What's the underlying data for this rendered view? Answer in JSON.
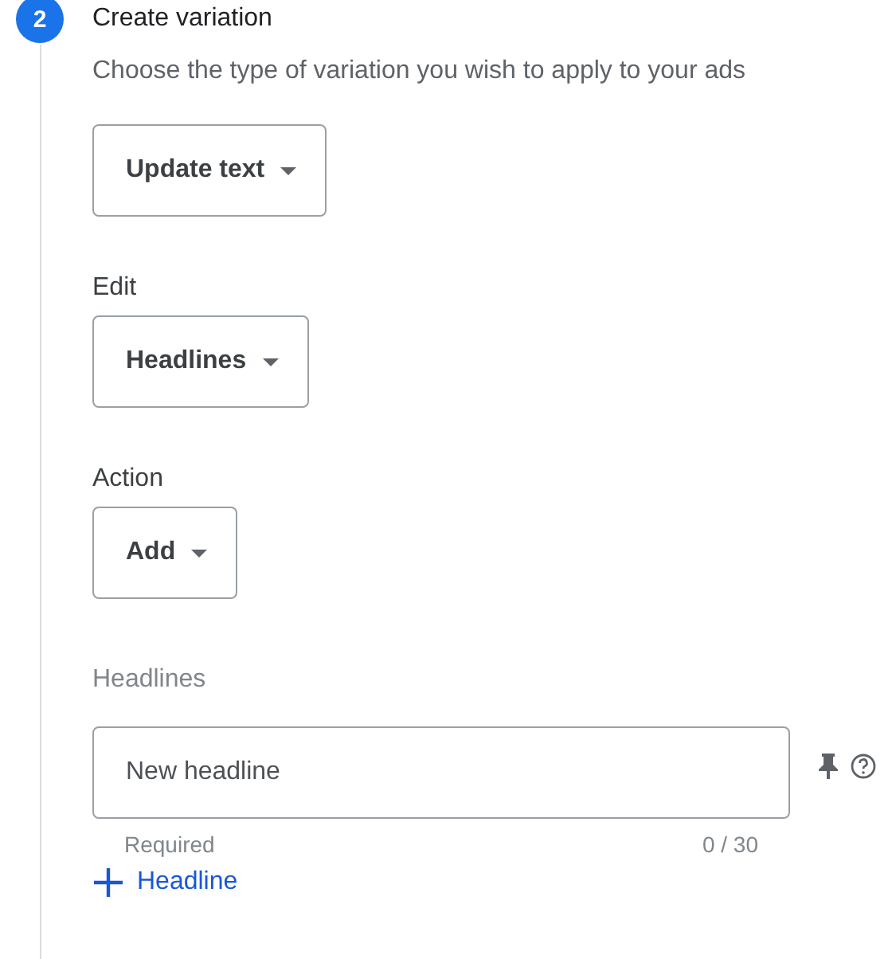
{
  "step": {
    "number": "2",
    "title": "Create variation"
  },
  "prompt": "Choose the type of variation you wish to apply to your ads",
  "dropdowns": [
    {
      "value": "Update text"
    },
    {
      "label": "Edit",
      "value": "Headlines"
    },
    {
      "label": "Action",
      "value": "Add"
    }
  ],
  "headlines": {
    "label": "Headlines",
    "field": {
      "placeholder": "New headline"
    },
    "helper": "Required",
    "counter": "0 / 30",
    "add_button": "Headline"
  }
}
